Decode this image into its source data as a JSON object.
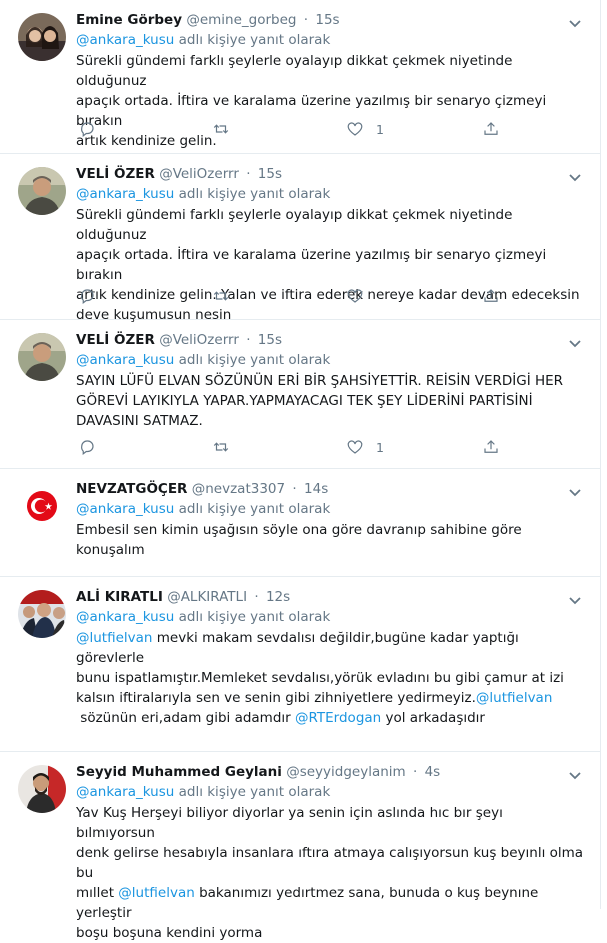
{
  "reply_suffix": "adlı kişiye yanıt olarak",
  "tweets": [
    {
      "name": "Emine Görbey",
      "handle": "@emine_gorbeg",
      "time": "15s",
      "reply_to": "@ankara_kusu",
      "lines": [
        "Sürekli gündemi farklı şeylerle oyalayıp dikkat çekmek niyetinde olduğunuz",
        "apaçık ortada. İftira ve karalama üzerine yazılmış bir senaryo çizmeyi bırakın",
        "artık kendinize gelin."
      ],
      "likes": "1"
    },
    {
      "name": "VELİ ÖZER",
      "handle": "@VeliOzerrr",
      "time": "15s",
      "reply_to": "@ankara_kusu",
      "lines": [
        "Sürekli gündemi farklı şeylerle oyalayıp dikkat çekmek niyetinde olduğunuz",
        "apaçık ortada. İftira ve karalama üzerine yazılmış bir senaryo çizmeyi bırakın",
        "artık kendinize gelin. Yalan ve iftira ederek nereye kadar devam edeceksin",
        "deve kuşumusun nesin"
      ],
      "likes": ""
    },
    {
      "name": "VELİ ÖZER",
      "handle": "@VeliOzerrr",
      "time": "15s",
      "reply_to": "@ankara_kusu",
      "lines": [
        "SAYIN LÜFÜ ELVAN SÖZÜNÜN ERİ BİR ŞAHSİYETTİR. REİSİN VERDİGİ HER",
        "GÖREVİ LAYIKIYLA YAPAR.YAPMAYACAGI TEK ŞEY LİDERİNİ PARTİSİNİ",
        "DAVASINI SATMAZ."
      ],
      "likes": "1"
    },
    {
      "name": "NEVZATGÖÇER",
      "handle": "@nevzat3307",
      "time": "14s",
      "reply_to": "@ankara_kusu",
      "lines": [
        "Embesil sen kimin uşağısın söyle ona göre davranıp sahibine göre konuşalım"
      ],
      "likes": ""
    },
    {
      "name": "ALİ KIRATLI",
      "handle": "@ALKIRATLI",
      "time": "12s",
      "reply_to": "@ankara_kusu",
      "rich_lines": [
        [
          {
            "t": "@lutfielvan",
            "link": true
          },
          {
            "t": " mevki makam sevdalısı değildir,bugüne kadar yaptığı görevlerle"
          }
        ],
        [
          {
            "t": "bunu ispatlamıştır.Memleket sevdalısı,yörük evladını bu gibi çamur at izi"
          }
        ],
        [
          {
            "t": "kalsın iftiralarıyla sen ve senin gibi zihniyetlere yedirmeyiz."
          },
          {
            "t": "@lutfielvan",
            "link": true
          }
        ],
        [
          {
            "t": " sözünün eri,adam gibi adamdır "
          },
          {
            "t": "@RTErdogan",
            "link": true
          },
          {
            "t": " yol arkadaşıdır"
          }
        ]
      ],
      "likes": ""
    },
    {
      "name": "Seyyid Muhammed Geylani",
      "handle": "@seyyidgeylanim",
      "time": "4s",
      "reply_to": "@ankara_kusu",
      "rich_lines": [
        [
          {
            "t": "Yav Kuş Herşeyi biliyor diyorlar ya senin için aslında hıc bır şeyı bılmıyorsun"
          }
        ],
        [
          {
            "t": "denk gelirse hesabıyla insanlara ıftıra atmaya calışıyorsun kuş beyınlı olma bu"
          }
        ],
        [
          {
            "t": "mıllet "
          },
          {
            "t": "@lutfielvan",
            "link": true
          },
          {
            "t": " bakanımızı yedırtmez sana, bunuda o kuş beynıne yerleştir"
          }
        ],
        [
          {
            "t": "boşu boşuna kendini yorma"
          }
        ]
      ],
      "likes": ""
    }
  ],
  "icons": [
    "reply-icon",
    "retweet-icon",
    "like-icon",
    "share-icon",
    "caret-down-icon"
  ],
  "colors": {
    "accent": "#1b95e0",
    "muted": "#657786",
    "text": "#14171a",
    "border": "#e6ecf0"
  }
}
